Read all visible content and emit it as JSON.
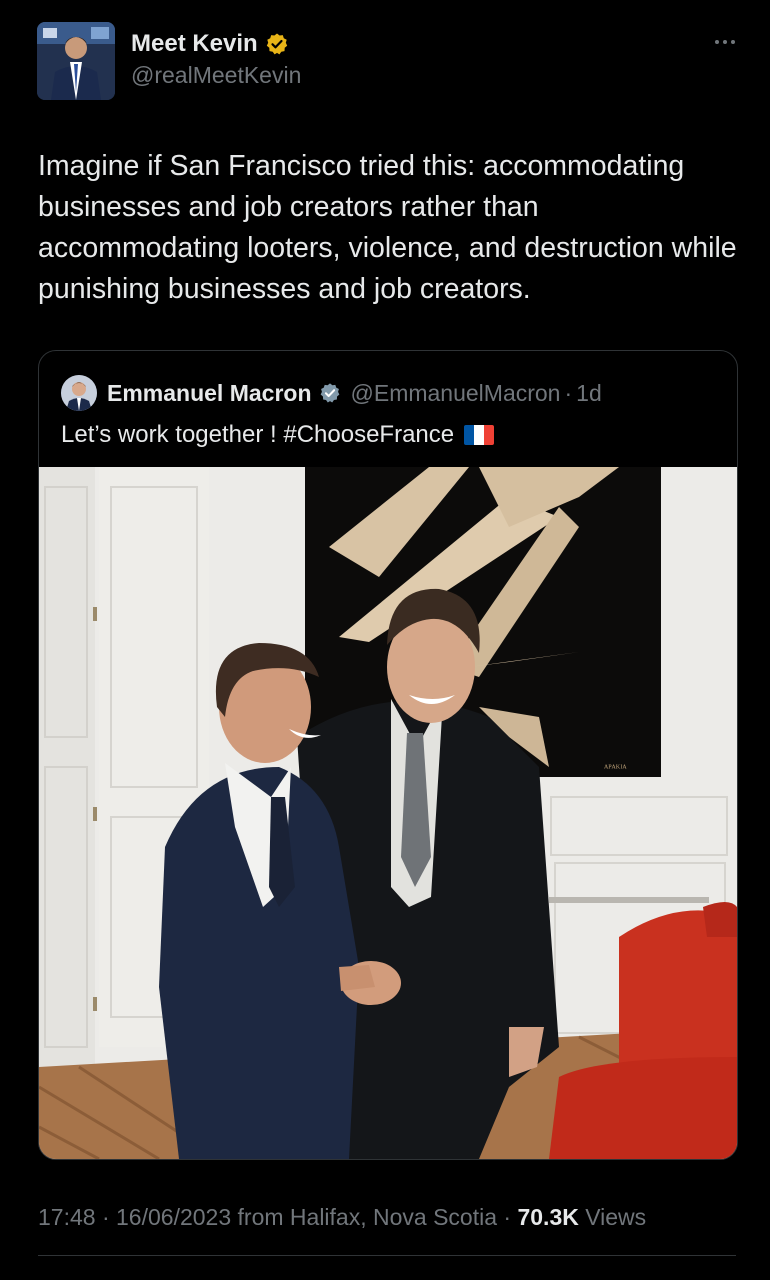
{
  "tweet": {
    "author_name": "Meet Kevin",
    "author_handle": "@realMeetKevin",
    "text": "Imagine if San Francisco tried this: accommodating businesses and job creators rather than accommodating looters, violence, and destruction while punishing businesses and job creators.",
    "time": "17:48",
    "date": "16/06/2023",
    "location_prefix": "from",
    "location": "Halifax, Nova Scotia",
    "views_count": "70.3K",
    "views_label": "Views",
    "separator": "·"
  },
  "quoted": {
    "author_name": "Emmanuel Macron",
    "author_handle": "@EmmanuelMacron",
    "separator": "·",
    "age": "1d",
    "text": "Let’s work together ! #ChooseFrance",
    "flag_icon": "france-flag-icon"
  },
  "colors": {
    "background": "#000000",
    "text": "#e7e9ea",
    "muted": "#71767b",
    "verified_gold": "#e8b417",
    "verified_gray": "#829aab",
    "border": "#2f3336"
  }
}
